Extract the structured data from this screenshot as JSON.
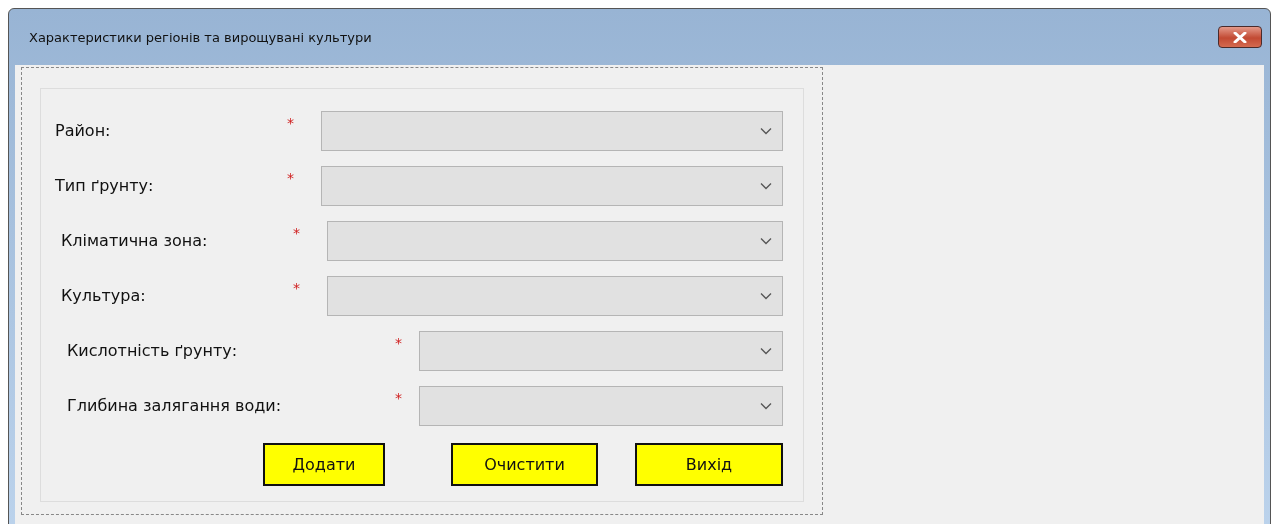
{
  "window": {
    "title": "Характеристики регіонів та вирощувані культури"
  },
  "fields": [
    {
      "label": "Район:",
      "required_mark": "*",
      "kind": "short"
    },
    {
      "label": "Тип ґрунту:",
      "required_mark": "*",
      "kind": "short"
    },
    {
      "label": "Кліматична зона:",
      "required_mark": "*",
      "kind": "short"
    },
    {
      "label": "Культура:",
      "required_mark": "*",
      "kind": "short"
    },
    {
      "label": "Кислотність ґрунту:",
      "required_mark": "*",
      "kind": "long"
    },
    {
      "label": "Глибина залягання води:",
      "required_mark": "*",
      "kind": "long"
    }
  ],
  "buttons": [
    "Додати",
    "Очистити",
    "Вихід"
  ]
}
